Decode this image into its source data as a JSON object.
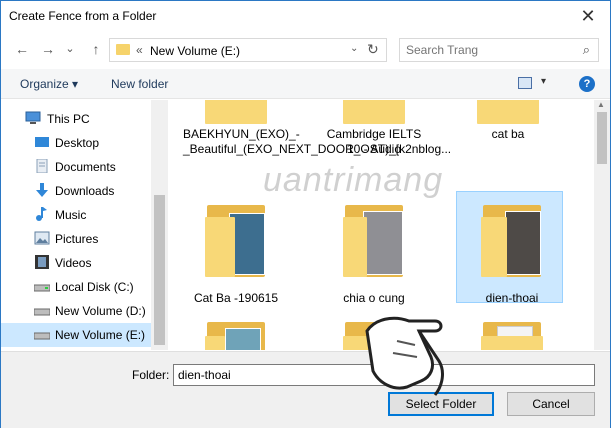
{
  "window": {
    "title": "Create Fence from a Folder",
    "close_glyph": "✕"
  },
  "nav": {
    "back_glyph": "←",
    "forward_glyph": "→",
    "recent_glyph": "⌄",
    "up_glyph": "↑",
    "address_chevron": "«",
    "address_path": "New Volume (E:)",
    "address_dropdown_glyph": "⌄",
    "refresh_glyph": "↻",
    "search_placeholder": "Search Trang",
    "search_glyph": "⌕"
  },
  "commands": {
    "organize": "Organize ▾",
    "new_folder": "New folder",
    "help_glyph": "?",
    "view_dd_glyph": "▾"
  },
  "sidebar": {
    "items": [
      {
        "label": "This PC",
        "icon": "computer-icon",
        "color": "#4a90d9"
      },
      {
        "label": "Desktop",
        "icon": "desktop-icon",
        "color": "#2f87d8"
      },
      {
        "label": "Documents",
        "icon": "documents-icon",
        "color": "#8aa0b8"
      },
      {
        "label": "Downloads",
        "icon": "downloads-icon",
        "color": "#2f87d8"
      },
      {
        "label": "Music",
        "icon": "music-icon",
        "color": "#2f87d8"
      },
      {
        "label": "Pictures",
        "icon": "pictures-icon",
        "color": "#5f7f9f"
      },
      {
        "label": "Videos",
        "icon": "videos-icon",
        "color": "#333333"
      },
      {
        "label": "Local Disk (C:)",
        "icon": "drive-icon",
        "color": "#6a6a6a"
      },
      {
        "label": "New Volume (D:)",
        "icon": "drive-icon",
        "color": "#6a6a6a"
      },
      {
        "label": "New Volume (E:)",
        "icon": "drive-icon",
        "color": "#6a6a6a"
      }
    ]
  },
  "files": [
    {
      "name": "BAEKHYUN_(EXO)_-_Beautiful_(EXO_NEXT_DOOR_OST)_[k2nblog..."
    },
    {
      "name": "Cambridge IELTS 10 - Audio"
    },
    {
      "name": "cat ba"
    },
    {
      "name": "Cat Ba -190615"
    },
    {
      "name": "chia o cung"
    },
    {
      "name": "dien-thoai"
    },
    {
      "name": ""
    },
    {
      "name": ""
    },
    {
      "name": ""
    }
  ],
  "bottom": {
    "folder_label": "Folder:",
    "folder_value": "dien-thoai",
    "select_button": "Select Folder",
    "cancel_button": "Cancel"
  },
  "watermark": "Quantrimang",
  "colors": {
    "accent": "#0078d7",
    "selection": "#cce8ff",
    "folder": "#f8d877"
  }
}
